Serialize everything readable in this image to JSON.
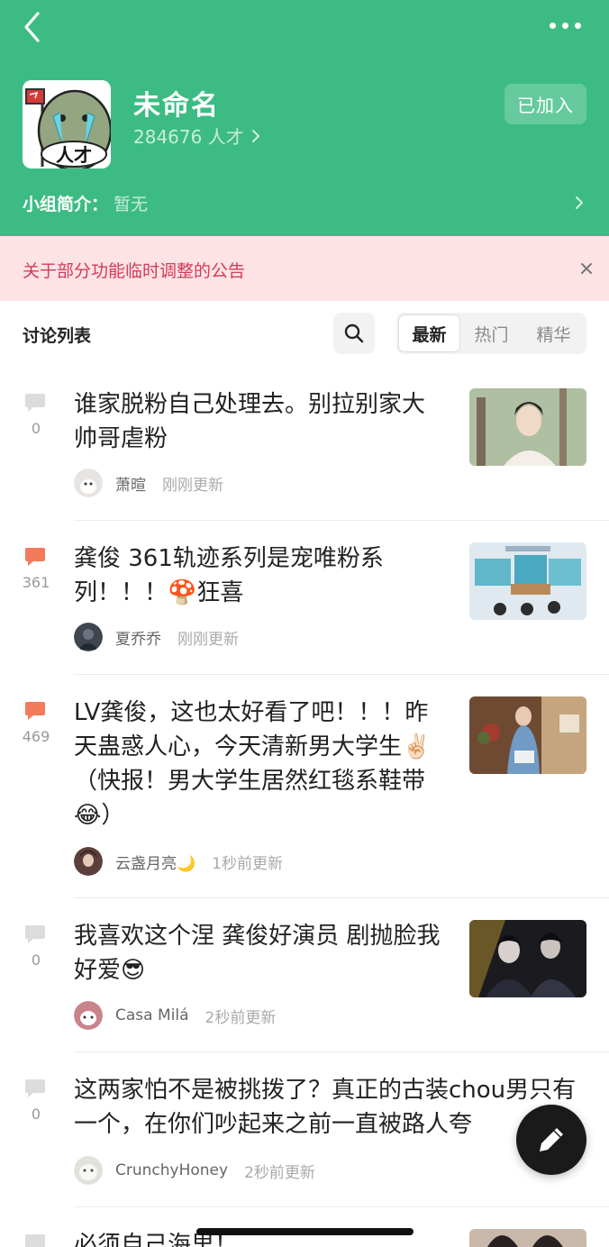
{
  "header": {
    "group_name": "未命名",
    "member_count": "284676 人才",
    "joined_label": "已加入",
    "intro_label": "小组简介：",
    "intro_value": "暂无",
    "avatar_text": "人才",
    "bg_color": "#3cbc84"
  },
  "notice": {
    "text": "关于部分功能临时调整的公告"
  },
  "toolbar": {
    "section_title": "讨论列表",
    "tabs": [
      {
        "label": "最新",
        "active": true
      },
      {
        "label": "热门",
        "active": false
      },
      {
        "label": "精华",
        "active": false
      }
    ]
  },
  "posts": [
    {
      "comment_count": "0",
      "comment_icon": "speech-bubble-icon",
      "title": "谁家脱粉自己处理去。别拉别家大帅哥虐粉",
      "author": "萧暄",
      "time": "刚刚更新",
      "has_thumbnail": true
    },
    {
      "comment_count": "361",
      "comment_icon": "speech-bubble-icon",
      "title": "龚俊 361轨迹系列是宠唯粉系列！！！🍄狂喜",
      "author": "夏乔乔",
      "time": "刚刚更新",
      "has_thumbnail": true
    },
    {
      "comment_count": "469",
      "comment_icon": "speech-bubble-icon",
      "title": "LV龚俊，这也太好看了吧！！！昨天蛊惑人心，今天清新男大学生✌🏻（快报！男大学生居然红毯系鞋带😂）",
      "author": "云盏月亮🌙",
      "time": "1秒前更新",
      "has_thumbnail": true
    },
    {
      "comment_count": "0",
      "comment_icon": "speech-bubble-icon",
      "title": "我喜欢这个涅 龚俊好演员 剧抛脸我好爱😎",
      "author": "Casa Milá",
      "time": "2秒前更新",
      "has_thumbnail": true
    },
    {
      "comment_count": "0",
      "comment_icon": "speech-bubble-icon",
      "title": "这两家怕不是被挑拨了？真正的古装chou男只有一个，在你们吵起来之前一直被路人夸",
      "author": "CrunchyHoney",
      "time": "2秒前更新",
      "has_thumbnail": false
    },
    {
      "comment_count": "",
      "comment_icon": "speech-bubble-icon",
      "title": "必须自己海里！",
      "has_thumbnail": true
    }
  ],
  "fab": {
    "icon": "pen-icon"
  },
  "icons": {
    "back": "back-arrow-icon",
    "more": "more-icon",
    "search": "search-icon",
    "close": "close-icon"
  },
  "colors": {
    "accent": "#3cbc84",
    "notice_bg": "#fde3e6",
    "notice_text": "#d23c57",
    "hot_comment": "#f47a5c",
    "cold_comment": "#dcdcdc"
  }
}
